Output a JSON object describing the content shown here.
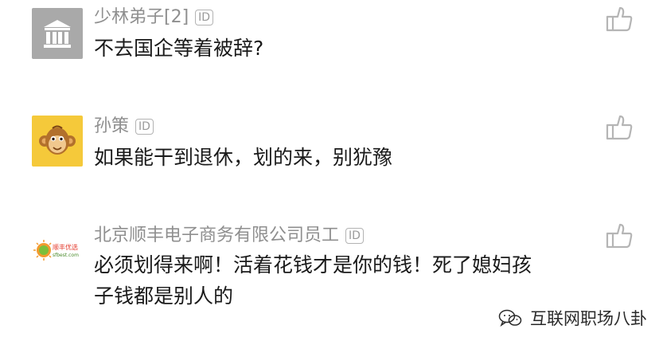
{
  "comments": [
    {
      "name": "少林弟子[2]",
      "badge": "ID",
      "text_lines": [
        "不去国企等着被辞?"
      ],
      "avatar": "bank-icon"
    },
    {
      "name": "孙策",
      "badge": "ID",
      "text_lines": [
        "如果能干到退休，划的来，别犹豫"
      ],
      "avatar": "monkey-avatar"
    },
    {
      "name": "北京顺丰电子商务有限公司员工",
      "badge": "ID",
      "text_lines": [
        "必须划得来啊！活着花钱才是你的钱！死了媳妇孩",
        "子钱都是别人的"
      ],
      "avatar": "sfbest-logo",
      "logo_text": "顺丰优选",
      "logo_sub": "sfbest.com"
    }
  ],
  "watermark": {
    "text": "互联网职场八卦",
    "icon": "wechat-icon"
  },
  "colors": {
    "name": "#8f8f8f",
    "text": "#1a1a1a",
    "like_icon": "#b5b5b5",
    "avatar_bank_bg": "#a9a9a9",
    "avatar_monkey_bg": "#f5c93a"
  }
}
